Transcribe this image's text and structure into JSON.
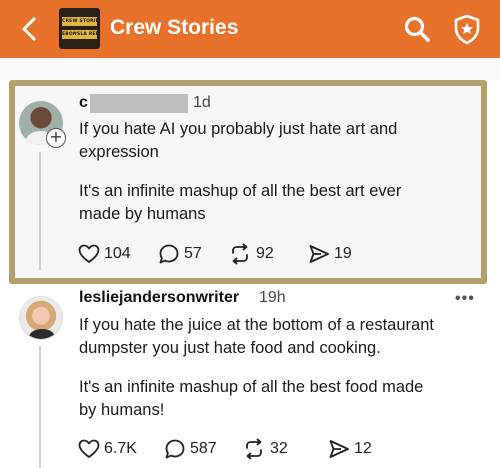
{
  "header": {
    "title": "Crew Stories",
    "logo_line1": "CREW STORIES",
    "logo_line2": "EBONSLA RERO",
    "bg_color": "#e8722c",
    "icons": [
      "back-chevron-icon",
      "search-icon",
      "shield-star-icon"
    ]
  },
  "posts": [
    {
      "username": "c",
      "username_redacted": true,
      "time": "1d",
      "paragraph1": "If you hate AI you probably just hate art and\nexpression",
      "paragraph2": "It's an infinite mashup of all the best art ever\nmade by humans",
      "likes": "104",
      "replies": "57",
      "reposts": "92",
      "shares": "19",
      "highlighted": true
    },
    {
      "username": "lesliejandersonwriter",
      "time": "19h",
      "more_label": "•••",
      "paragraph1": "If you hate the juice at the bottom of a restaurant\ndumpster you just hate food and cooking.",
      "paragraph2": "It's an infinite mashup of all the best food made\nby humans!",
      "likes": "6.7K",
      "replies": "587",
      "reposts": "32",
      "shares": "12"
    }
  ],
  "colors": {
    "highlight_border": "#b59f6a",
    "accent": "#e8722c"
  }
}
